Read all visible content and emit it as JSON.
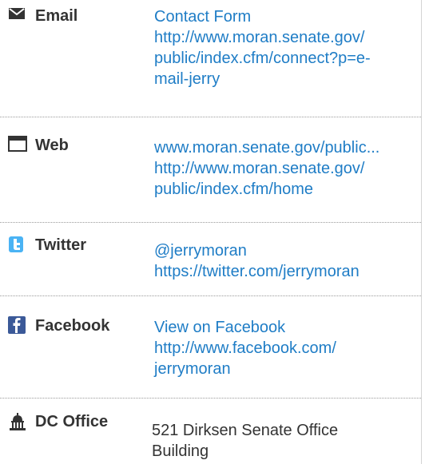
{
  "rows": [
    {
      "label": "Email",
      "icon": "envelope-icon",
      "lines": [
        "Contact Form",
        "http://www.moran.senate.gov/",
        "public/index.cfm/connect?p=e-",
        "mail-jerry"
      ]
    },
    {
      "label": "Web",
      "icon": "browser-window-icon",
      "lines": [
        "www.moran.senate.gov/public...",
        "http://www.moran.senate.gov/",
        "public/index.cfm/home"
      ]
    },
    {
      "label": "Twitter",
      "icon": "twitter-icon",
      "lines": [
        "@jerrymoran",
        "https://twitter.com/jerrymoran"
      ]
    },
    {
      "label": "Facebook",
      "icon": "facebook-icon",
      "lines": [
        "View on Facebook",
        "http://www.facebook.com/",
        "jerrymoran"
      ]
    },
    {
      "label": "DC Office",
      "icon": "capitol-building-icon",
      "lines": [
        "521 Dirksen Senate Office",
        "Building"
      ]
    }
  ],
  "colors": {
    "link": "#1f7dc6",
    "label": "#333333",
    "separator": "#9a9a9a"
  }
}
